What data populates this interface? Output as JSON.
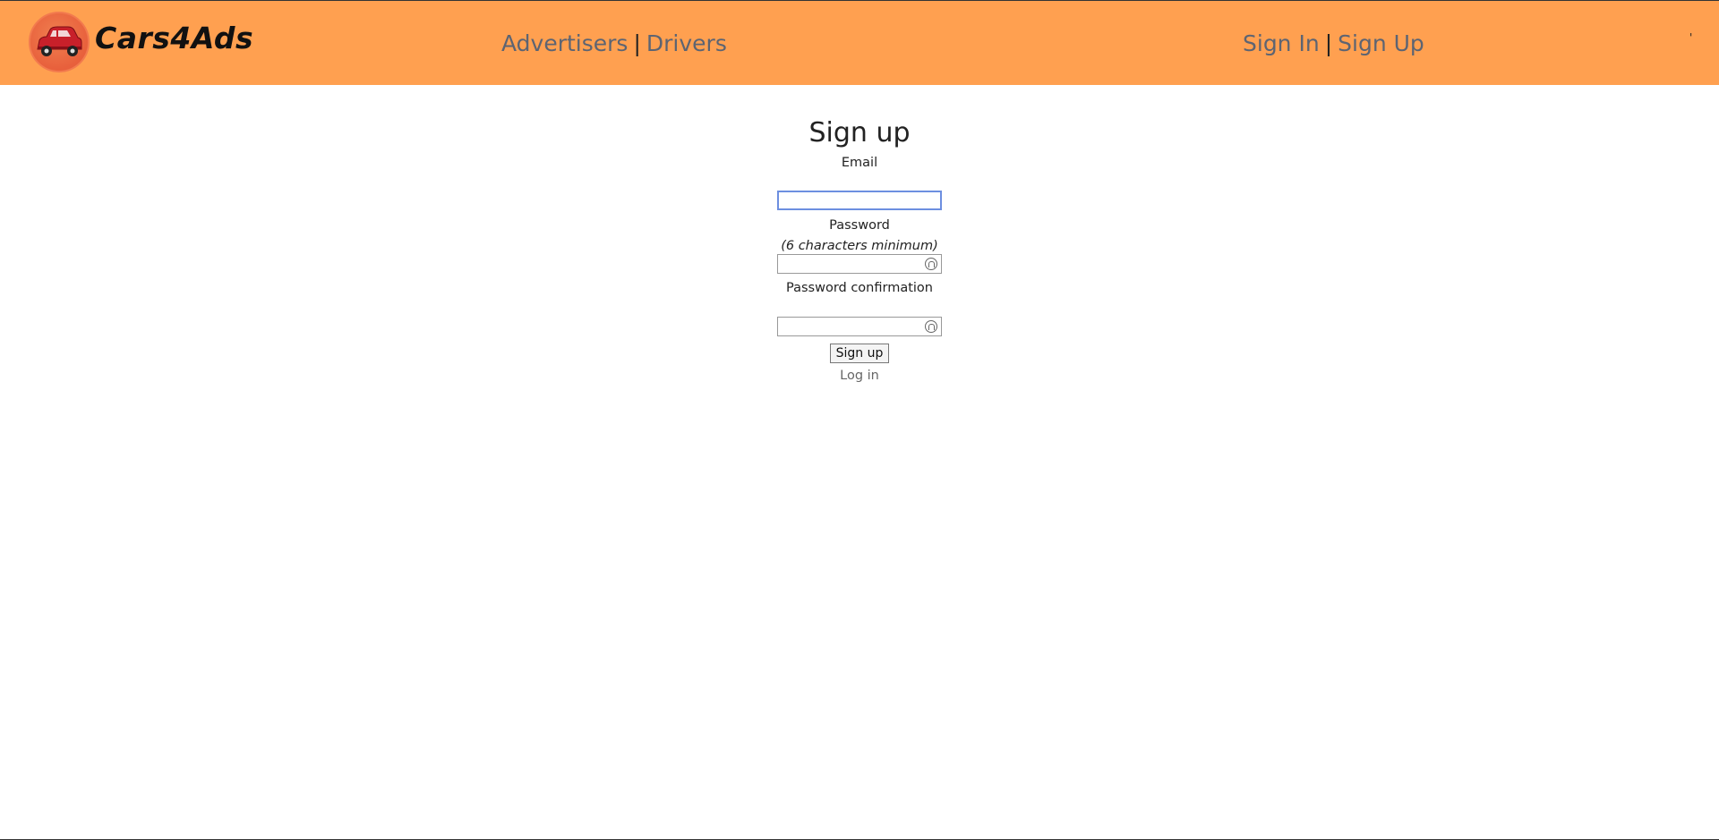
{
  "header": {
    "brand": "Cars4Ads",
    "nav_left": [
      "Advertisers",
      "Drivers"
    ],
    "nav_right": [
      "Sign In",
      "Sign Up"
    ],
    "separator": "|",
    "corner_mark": "'",
    "colors": {
      "bar": "#ffa050",
      "link": "#5d6472"
    }
  },
  "form": {
    "title": "Sign up",
    "email_label": "Email",
    "password_label": "Password",
    "password_hint": "(6 characters minimum)",
    "confirmation_label": "Password confirmation",
    "submit_label": "Sign up",
    "login_link": "Log in"
  }
}
